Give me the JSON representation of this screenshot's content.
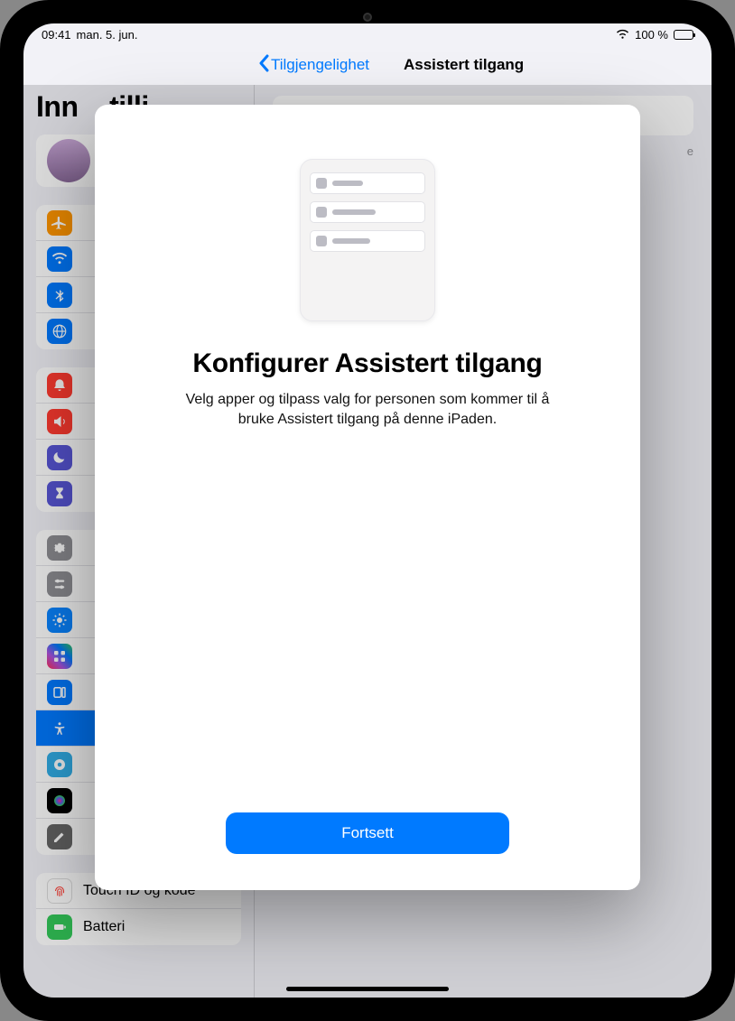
{
  "status": {
    "time": "09:41",
    "date": "man. 5. jun.",
    "battery_pct": "100 %"
  },
  "nav": {
    "back_label": "Tilgjengelighet",
    "title": "Assistert tilgang"
  },
  "sidebar": {
    "heading_fragment": "Inn",
    "heading_fragment2": "tilli",
    "items_bottom": {
      "touchid": "Touch ID og kode",
      "battery": "Batteri"
    }
  },
  "content": {
    "hint_fragment": "e"
  },
  "modal": {
    "title": "Konfigurer Assistert tilgang",
    "body": "Velg apper og tilpass valg for personen som kommer til å bruke Assistert tilgang på denne iPaden.",
    "continue_label": "Fortsett"
  }
}
